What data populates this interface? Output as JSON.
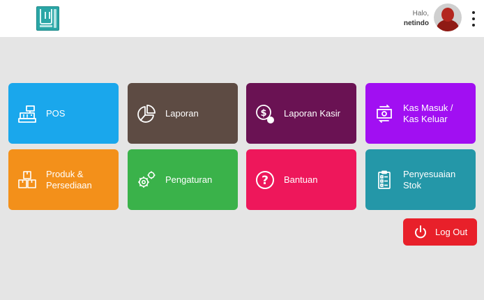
{
  "header": {
    "greeting": "Halo,",
    "username": "netindo"
  },
  "tiles": [
    {
      "label": "POS",
      "color": "#1aa7ec",
      "icon": "cash-register-icon"
    },
    {
      "label": "Laporan",
      "color": "#5d4b43",
      "icon": "pie-chart-icon"
    },
    {
      "label": "Laporan Kasir",
      "color": "#6a1253",
      "icon": "coin-hand-icon"
    },
    {
      "label": "Kas Masuk /\nKas Keluar",
      "color": "#a10ff2",
      "icon": "cash-exchange-icon"
    },
    {
      "label": "Produk &\nPersediaan",
      "color": "#f3901a",
      "icon": "boxes-icon"
    },
    {
      "label": "Pengaturan",
      "color": "#3ab24a",
      "icon": "gears-icon"
    },
    {
      "label": "Bantuan",
      "color": "#ee175b",
      "icon": "question-circle-icon"
    },
    {
      "label": "Penyesuaian\nStok",
      "color": "#2497a8",
      "icon": "clipboard-list-icon"
    }
  ],
  "logout": {
    "label": "Log Out",
    "color": "#e8202a",
    "icon": "power-icon"
  }
}
